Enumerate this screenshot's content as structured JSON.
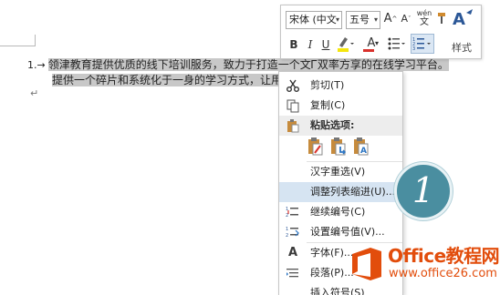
{
  "document": {
    "list_number": "1.→",
    "line1_text": "领津教育提供优质的线下培训服务，致力于打造一个文Ꮁ双率方享的在线学习平台。",
    "line2_text": "提供一个碎片和系统化于一身的学习方式，让用户可以",
    "paragraph_mark": "↵"
  },
  "mini_toolbar": {
    "font_name": "宋体 (中文",
    "font_size": "五号",
    "grow_font": "A",
    "shrink_font": "A",
    "phonetic": "wén",
    "bold": "B",
    "italic": "I",
    "underline": "U",
    "font_color": "A",
    "styles_label": "样式"
  },
  "context_menu": {
    "items": [
      {
        "label": "剪切(T)",
        "icon": "scissors-icon"
      },
      {
        "label": "复制(C)",
        "icon": "copy-icon"
      },
      {
        "label": "粘贴选项:",
        "icon": "paste-icon"
      },
      {
        "label": "汉字重选(V)",
        "icon": ""
      },
      {
        "label": "调整列表缩进(U)...",
        "icon": ""
      },
      {
        "label": "继续编号(C)",
        "icon": "continue-numbering-icon"
      },
      {
        "label": "设置编号值(V)...",
        "icon": "set-numbering-value-icon"
      },
      {
        "label": "字体(F)...",
        "icon": "font-icon"
      },
      {
        "label": "段落(P)...",
        "icon": "paragraph-icon"
      },
      {
        "label": "插入符号(S)",
        "icon": ""
      }
    ],
    "hover_index": 4
  },
  "step_badge": "1",
  "watermark": {
    "title": "Office教程网",
    "url": "www.office26.com"
  },
  "colors": {
    "selection": "#c8c8c8",
    "menu_hover": "#d6e4f2",
    "badge": "#4a8ea0",
    "brand": "#e24d0c",
    "font_color_red": "#d9312b",
    "highlight_yellow": "#f5e60c"
  }
}
